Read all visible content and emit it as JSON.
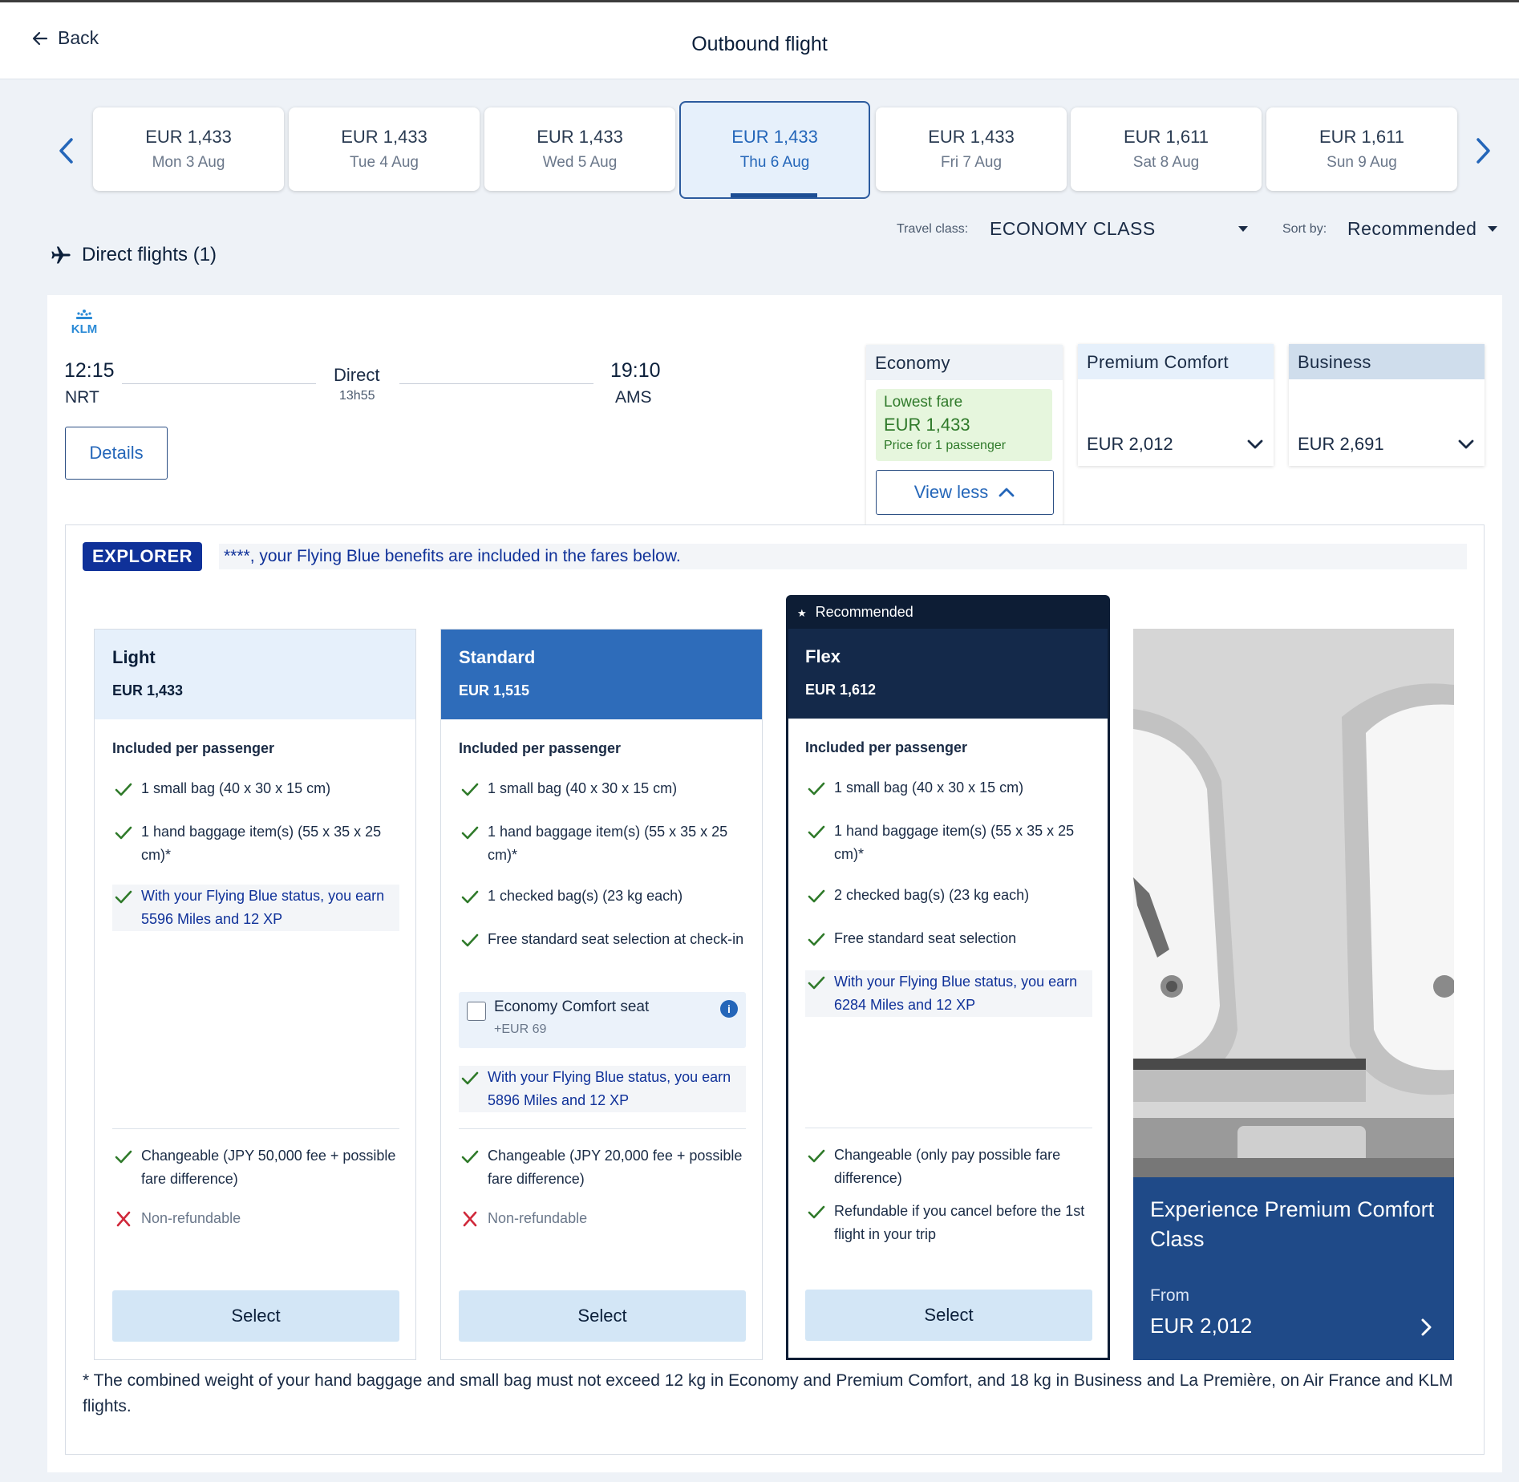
{
  "header": {
    "back_label": "Back",
    "title": "Outbound flight"
  },
  "dates": [
    {
      "price": "EUR 1,433",
      "day": "Mon 3 Aug"
    },
    {
      "price": "EUR 1,433",
      "day": "Tue 4 Aug"
    },
    {
      "price": "EUR 1,433",
      "day": "Wed 5 Aug"
    },
    {
      "price": "EUR 1,433",
      "day": "Thu 6 Aug",
      "selected": true
    },
    {
      "price": "EUR 1,433",
      "day": "Fri 7 Aug"
    },
    {
      "price": "EUR 1,611",
      "day": "Sat 8 Aug"
    },
    {
      "price": "EUR 1,611",
      "day": "Sun 9 Aug"
    }
  ],
  "filters": {
    "travel_class_label": "Travel class:",
    "travel_class_value": "ECONOMY CLASS",
    "sort_label": "Sort by:",
    "sort_value": "Recommended"
  },
  "direct_flights_label": "Direct flights (1)",
  "flight": {
    "airline": "KLM",
    "depart_time": "12:15",
    "depart_airport": "NRT",
    "stops": "Direct",
    "duration": "13h55",
    "arrive_time": "19:10",
    "arrive_airport": "AMS",
    "details_label": "Details"
  },
  "cabins": {
    "economy": {
      "title": "Economy",
      "lowest_label": "Lowest fare",
      "lowest_price": "EUR 1,433",
      "price_note": "Price for 1 passenger",
      "view_less_label": "View less"
    },
    "premium": {
      "title": "Premium Comfort",
      "price": "EUR 2,012"
    },
    "business": {
      "title": "Business",
      "price": "EUR 2,691"
    }
  },
  "explorer": {
    "badge": "EXPLORER",
    "message": "****, your Flying Blue benefits are included in the fares below."
  },
  "fares": {
    "light": {
      "name": "Light",
      "price": "EUR 1,433",
      "included_title": "Included per passenger",
      "f1": "1 small bag (40 x 30 x 15 cm)",
      "f2": "1 hand baggage item(s) (55 x 35 x 25 cm)*",
      "f3": "With your Flying Blue status, you earn 5596 Miles and 12 XP",
      "c1": "Changeable (JPY 50,000 fee + possible fare difference)",
      "c2": "Non-refundable",
      "select_label": "Select"
    },
    "standard": {
      "name": "Standard",
      "price": "EUR 1,515",
      "included_title": "Included per passenger",
      "f1": "1 small bag (40 x 30 x 15 cm)",
      "f2": "1 hand baggage item(s) (55 x 35 x 25 cm)*",
      "f3": "1 checked bag(s) (23 kg each)",
      "f4": "Free standard seat selection at check-in",
      "upsell_label": "Economy Comfort seat",
      "upsell_price": "+EUR 69",
      "f5": "With your Flying Blue status, you earn 5896 Miles and 12 XP",
      "c1": "Changeable (JPY 20,000 fee + possible fare difference)",
      "c2": "Non-refundable",
      "select_label": "Select"
    },
    "flex": {
      "badge": "Recommended",
      "name": "Flex",
      "price": "EUR 1,612",
      "included_title": "Included per passenger",
      "f1": "1 small bag (40 x 30 x 15 cm)",
      "f2": "1 hand baggage item(s) (55 x 35 x 25 cm)*",
      "f3": "2 checked bag(s) (23 kg each)",
      "f4": "Free standard seat selection",
      "f5": "With your Flying Blue status, you earn 6284 Miles and 12 XP",
      "c1": "Changeable (only pay possible fare difference)",
      "c2": "Refundable if you cancel before the 1st flight in your trip",
      "select_label": "Select"
    }
  },
  "promo": {
    "title": "Experience Premium Comfort Class",
    "from_label": "From",
    "price": "EUR 2,012"
  },
  "footnote": "* The combined weight of your hand baggage and small bag must not exceed 12 kg in Economy and Premium Comfort, and 18 kg in Business and La Première, on Air France and KLM flights.",
  "colors": {
    "brand_blue": "#2466b9",
    "standard_header": "#2e6cba",
    "flex_header": "#14294a",
    "light_header": "#e6f0fb",
    "check_green": "#2f7a2a",
    "cross_red": "#d0283a",
    "lowest_bg": "#e6f6dd",
    "select_bg": "#d3e6f6"
  }
}
